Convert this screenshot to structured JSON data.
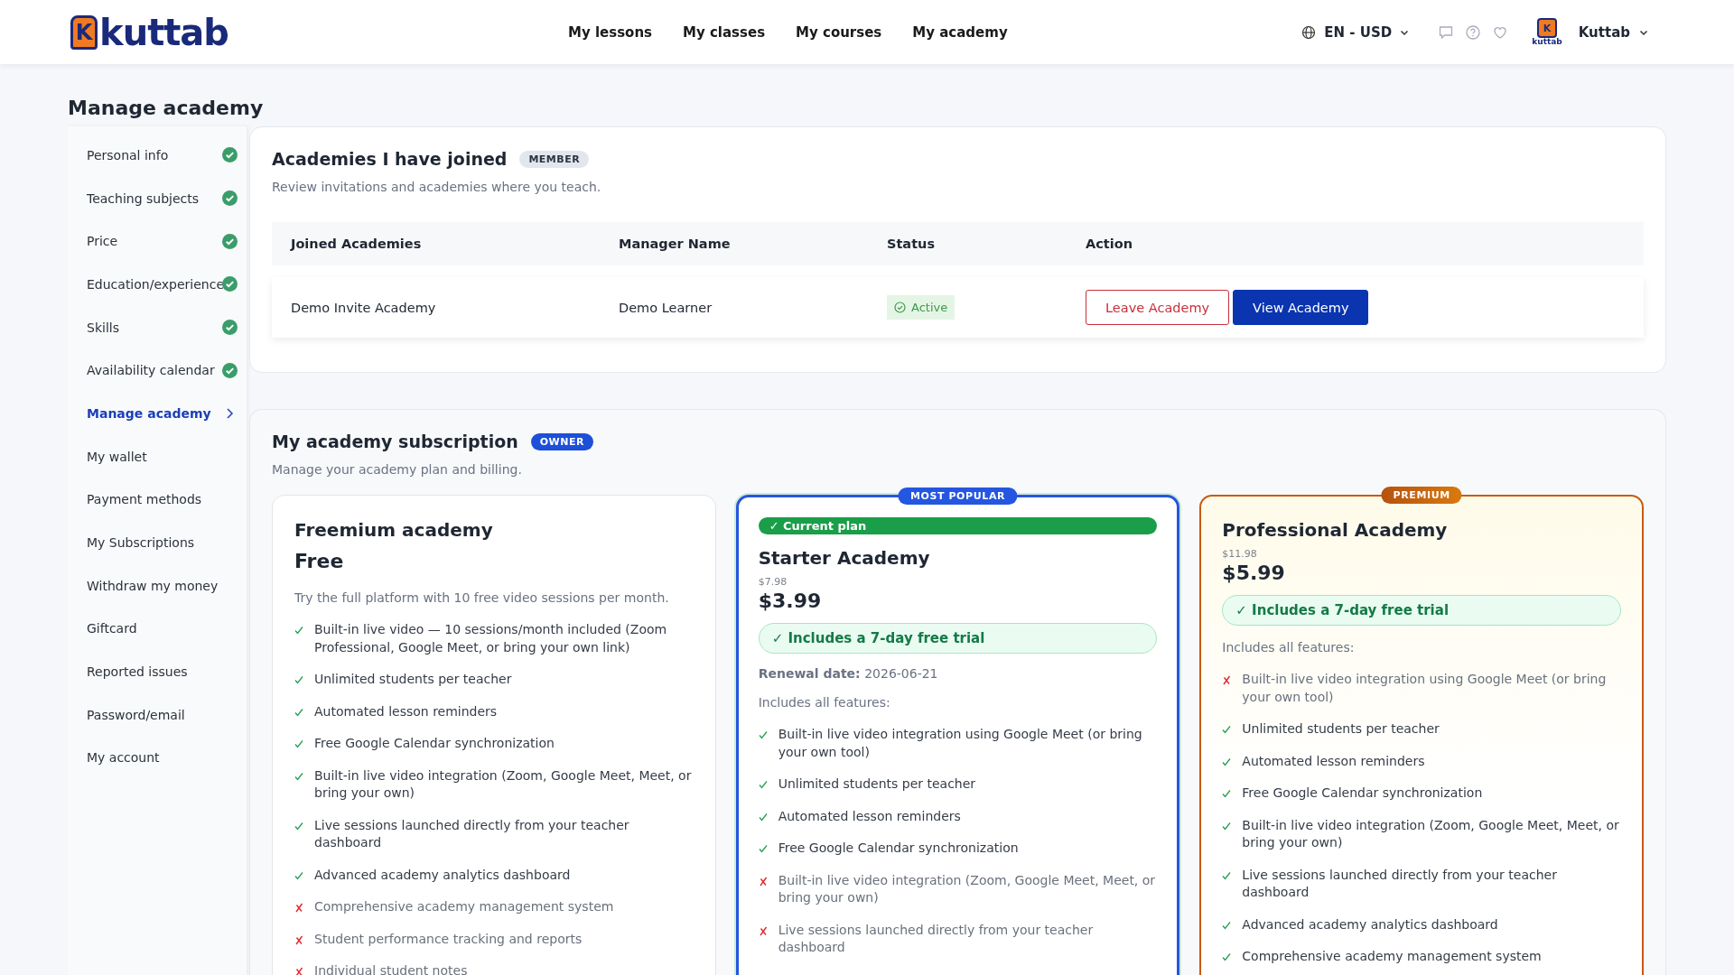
{
  "header": {
    "logo": {
      "mark": "K",
      "text": "kuttab"
    },
    "nav": [
      {
        "label": "My lessons"
      },
      {
        "label": "My classes"
      },
      {
        "label": "My courses"
      },
      {
        "label": "My academy"
      }
    ],
    "locale": "EN - USD",
    "avatar": {
      "mark": "K",
      "caption": "kuttab"
    },
    "user": "Kuttab"
  },
  "page_title": "Manage academy",
  "sidebar": {
    "items": [
      {
        "label": "Personal info",
        "completed": true,
        "selected": false
      },
      {
        "label": "Teaching subjects",
        "completed": true,
        "selected": false
      },
      {
        "label": "Price",
        "completed": true,
        "selected": false
      },
      {
        "label": "Education/experience",
        "completed": true,
        "selected": false
      },
      {
        "label": "Skills",
        "completed": true,
        "selected": false
      },
      {
        "label": "Availability calendar",
        "completed": true,
        "selected": false
      },
      {
        "label": "Manage academy",
        "completed": false,
        "selected": true
      },
      {
        "label": "My wallet",
        "completed": false,
        "selected": false
      },
      {
        "label": "Payment methods",
        "completed": false,
        "selected": false
      },
      {
        "label": "My Subscriptions",
        "completed": false,
        "selected": false
      },
      {
        "label": "Withdraw my money",
        "completed": false,
        "selected": false
      },
      {
        "label": "Giftcard",
        "completed": false,
        "selected": false
      },
      {
        "label": "Reported issues",
        "completed": false,
        "selected": false
      },
      {
        "label": "Password/email",
        "completed": false,
        "selected": false
      },
      {
        "label": "My account",
        "completed": false,
        "selected": false
      }
    ]
  },
  "joined": {
    "title": "Academies I have joined",
    "badge": "MEMBER",
    "subtitle": "Review invitations and academies where you teach.",
    "table": {
      "columns": [
        "Joined Academies",
        "Manager Name",
        "Status",
        "Action"
      ],
      "rows": [
        {
          "academy": "Demo Invite Academy",
          "manager": "Demo Learner",
          "status": {
            "label": "Active",
            "kind": "active"
          },
          "actions": [
            {
              "label": "Leave Academy",
              "kind": "outline"
            },
            {
              "label": "View Academy",
              "kind": "primary"
            }
          ]
        }
      ]
    }
  },
  "subscription": {
    "title": "My academy subscription",
    "badge": "OWNER",
    "subtitle": "Manage your academy plan and billing.",
    "plans": [
      {
        "kind": "basic",
        "name": "Freemium academy",
        "price": "Free",
        "description": "Try the full platform with 10 free video sessions per month.",
        "features": [
          {
            "text": "Built-in live video — 10 sessions/month included (Zoom Professional, Google Meet, or bring your own link)",
            "included": true
          },
          {
            "text": "Unlimited students per teacher",
            "included": true
          },
          {
            "text": "Automated lesson reminders",
            "included": true
          },
          {
            "text": "Free Google Calendar synchronization",
            "included": true
          },
          {
            "text": "Built-in live video integration (Zoom, Google Meet, Meet, or bring your own)",
            "included": true
          },
          {
            "text": "Live sessions launched directly from your teacher dashboard",
            "included": true
          },
          {
            "text": "Advanced academy analytics dashboard",
            "included": true
          },
          {
            "text": "Comprehensive academy management system",
            "included": false
          },
          {
            "text": "Student performance tracking and reports",
            "included": false
          },
          {
            "text": "Individual student notes",
            "included": false
          }
        ]
      },
      {
        "kind": "popular",
        "ribbon": "MOST POPULAR",
        "current_label": "✓ Current plan",
        "name": "Starter Academy",
        "old_price": "$7.98",
        "price": "$3.99",
        "trial": "✓ Includes a 7-day free trial",
        "renewal_label": "Renewal date:",
        "renewal_value": "2026-06-21",
        "features_intro": "Includes all features:",
        "features": [
          {
            "text": "Built-in live video integration using Google Meet (or bring your own tool)",
            "included": true
          },
          {
            "text": "Unlimited students per teacher",
            "included": true
          },
          {
            "text": "Automated lesson reminders",
            "included": true
          },
          {
            "text": "Free Google Calendar synchronization",
            "included": true
          },
          {
            "text": "Built-in live video integration (Zoom, Google Meet, Meet, or bring your own)",
            "included": false
          },
          {
            "text": "Live sessions launched directly from your teacher dashboard",
            "included": false
          }
        ]
      },
      {
        "kind": "premium",
        "ribbon": "PREMIUM",
        "name": "Professional Academy",
        "old_price": "$11.98",
        "price": "$5.99",
        "trial": "✓ Includes a 7-day free trial",
        "features_intro": "Includes all features:",
        "features": [
          {
            "text": "Built-in live video integration using Google Meet (or bring your own tool)",
            "included": false
          },
          {
            "text": "Unlimited students per teacher",
            "included": true
          },
          {
            "text": "Automated lesson reminders",
            "included": true
          },
          {
            "text": "Free Google Calendar synchronization",
            "included": true
          },
          {
            "text": "Built-in live video integration (Zoom, Google Meet, Meet, or bring your own)",
            "included": true
          },
          {
            "text": "Live sessions launched directly from your teacher dashboard",
            "included": true
          },
          {
            "text": "Advanced academy analytics dashboard",
            "included": true
          },
          {
            "text": "Comprehensive academy management system",
            "included": true
          }
        ]
      }
    ]
  }
}
